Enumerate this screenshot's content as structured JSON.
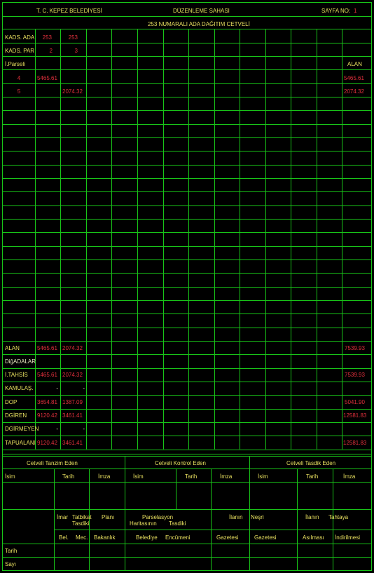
{
  "header": {
    "institution": "T. C.  KEPEZ  BELEDİYESİ",
    "area": "DÜZENLEME  SAHASI",
    "page_label": "SAYFA NO:",
    "page_no": "1",
    "subtitle": "253  NUMARALI  ADA  DAĞITIM  CETVELİ"
  },
  "rows_top": {
    "kads_ada": {
      "label": "KADS. ADA",
      "values": [
        "253",
        "253"
      ]
    },
    "kads_par": {
      "label": "KADS. PAR",
      "values": [
        "2",
        "3"
      ]
    },
    "iparseli": {
      "label": "İ.Parseli",
      "alan": "ALAN"
    }
  },
  "parcels": [
    {
      "no": "4",
      "v1": "5465.61",
      "v2": "",
      "alan": "5465.61"
    },
    {
      "no": "5",
      "v1": "",
      "v2": "2074.32",
      "alan": "2074.32"
    }
  ],
  "summary": [
    {
      "label": "ALAN",
      "v1": "5465.61",
      "v2": "2074.32",
      "total": "7539.93"
    },
    {
      "label": "DiğADALAR",
      "v1": "",
      "v2": "",
      "total": ""
    },
    {
      "label": "İ.TAHSİS",
      "v1": "5465.61",
      "v2": "2074.32",
      "total": "7539.93"
    },
    {
      "label": "KAMULAŞ.",
      "v1": "-",
      "v2": "-",
      "total": ""
    },
    {
      "label": "DOP",
      "v1": "3654.81",
      "v2": "1387.09",
      "total": "5041.90"
    },
    {
      "label": "DGİREN",
      "v1": "9120.42",
      "v2": "3461.41",
      "total": "12581.83"
    },
    {
      "label": "DGİRMEYEN",
      "v1": "-",
      "v2": "-",
      "total": ""
    },
    {
      "label": "TAPUALANI",
      "v1": "9120.42",
      "v2": "3461.41",
      "total": "12581.83"
    }
  ],
  "footer": {
    "groups": [
      "Cetveli     Tanzim   Eden",
      "Cetveli     Kontrol    Eden",
      "Cetveli     Tasdik    Eden"
    ],
    "cols": [
      "İsim",
      "Tarih",
      "İmza",
      "İsim",
      "Tarih",
      "İmza",
      "İsim",
      "Tarih",
      "İmza"
    ],
    "imar": "İmar",
    "tatbikat": "Tatbikat",
    "tasdiki1": "Tasdiki",
    "plani": "Planı",
    "parselasyon": "Parselasyon",
    "haritasinin": "Haritasının",
    "tasdiki2": "Tasdiki",
    "ilanin1": "İlanın",
    "nesri": "Neşri",
    "ilanin2": "İlanın",
    "tahtaya": "Tahtaya",
    "bel": "Bel.",
    "mec": "Mec.",
    "bakanlik": "Bakanlık",
    "belediye": "Belediye",
    "encumeni": "Encümeni",
    "gazetesi1": "Gazetesi",
    "gazetesi2": "Gazetesi",
    "asilmasi": "Asılması",
    "indirilmesi": "İndirilmesi",
    "tarih": "Tarih",
    "sayi": "Sayı"
  },
  "colors": {
    "grid": "#18c418",
    "label": "#e8e060",
    "value": "#e0303c",
    "bg": "#000000"
  }
}
